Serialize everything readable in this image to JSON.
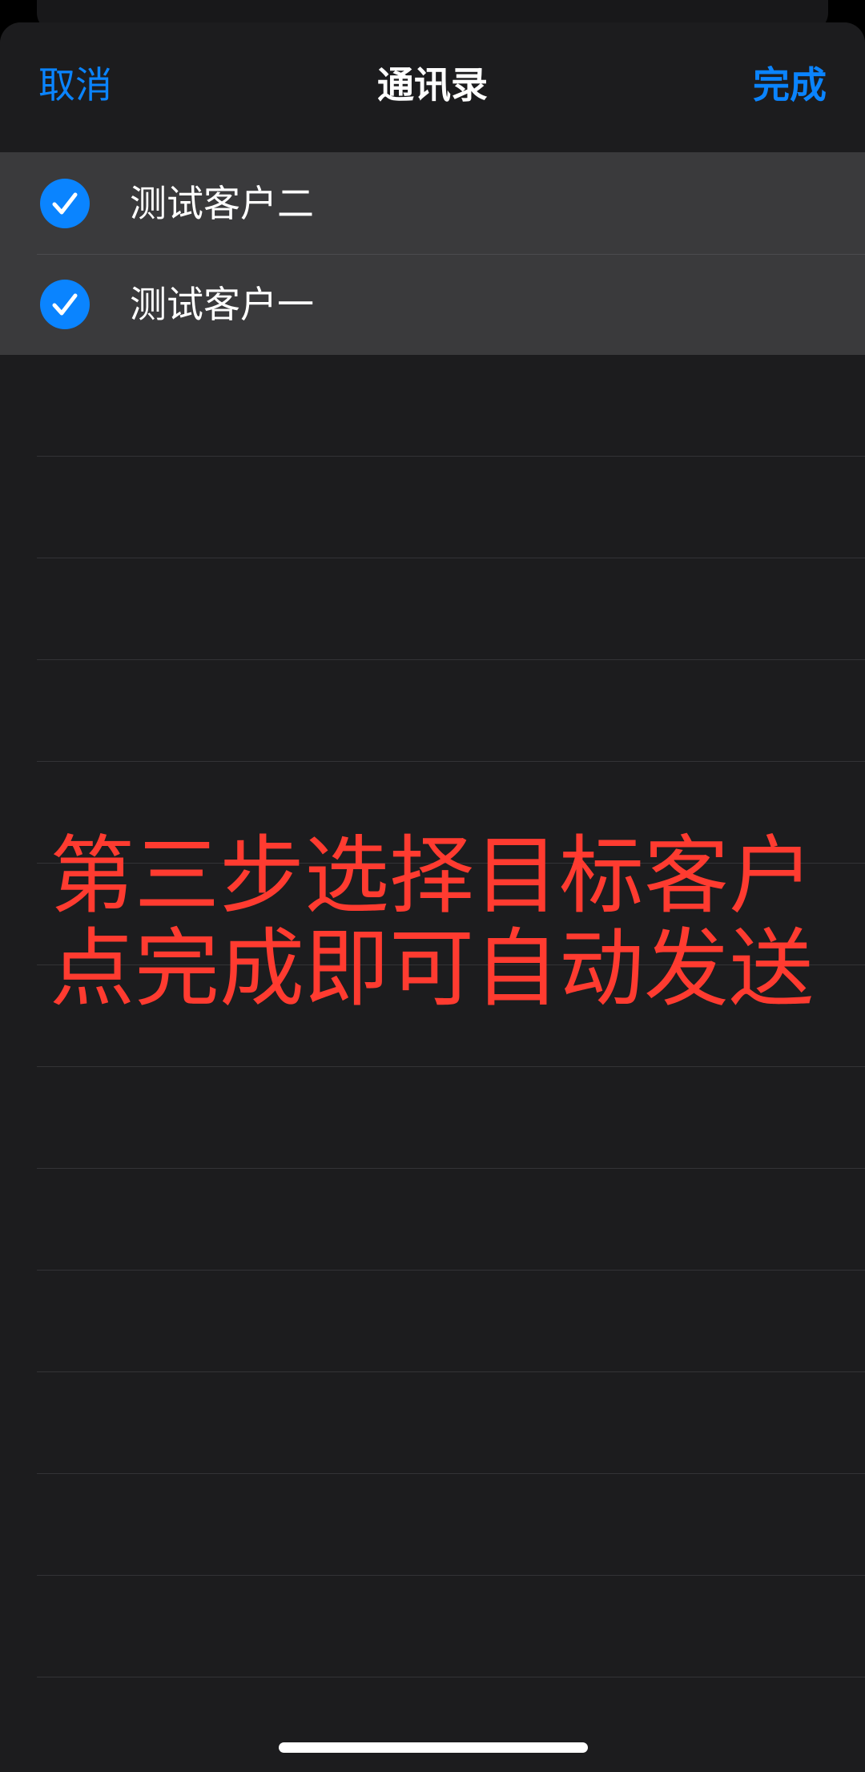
{
  "nav": {
    "cancel_label": "取消",
    "title": "通讯录",
    "done_label": "完成",
    "accent_color": "#0a84ff"
  },
  "contacts": [
    {
      "name": "测试客户二",
      "selected": true,
      "check_icon": "checkmark-circle-icon"
    },
    {
      "name": "测试客户一",
      "selected": true,
      "check_icon": "checkmark-circle-icon"
    }
  ],
  "overlay": {
    "line1": "第三步选择目标客户",
    "line2": "点完成即可自动发送",
    "color": "#ff3b30"
  }
}
